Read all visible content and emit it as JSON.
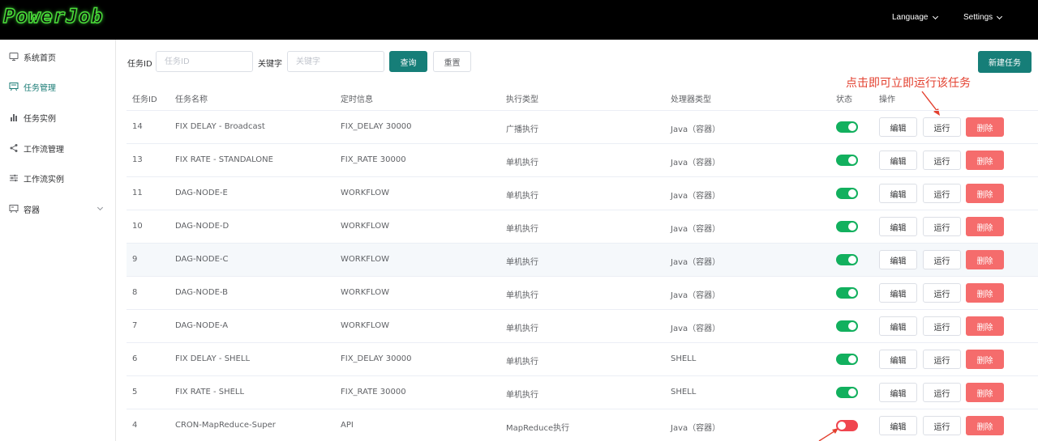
{
  "header": {
    "logo": "PowerJob",
    "language_label": "Language",
    "settings_label": "Settings"
  },
  "sidebar": {
    "items": [
      {
        "label": "系统首页",
        "icon": "monitor-icon"
      },
      {
        "label": "任务管理",
        "icon": "task-board-icon",
        "active": true
      },
      {
        "label": "任务实例",
        "icon": "bar-chart-icon"
      },
      {
        "label": "工作流管理",
        "icon": "share-icon"
      },
      {
        "label": "工作流实例",
        "icon": "sliders-icon"
      },
      {
        "label": "容器",
        "icon": "presentation-icon",
        "expandable": true
      }
    ]
  },
  "search": {
    "task_id_label": "任务ID",
    "task_id_placeholder": "任务ID",
    "keyword_label": "关键字",
    "keyword_placeholder": "关键字",
    "query_button": "查询",
    "reset_button": "重置",
    "new_task_button": "新建任务"
  },
  "annotation": {
    "text": "点击即可立即运行该任务",
    "color": "#e3402f"
  },
  "table": {
    "columns": [
      "任务ID",
      "任务名称",
      "定时信息",
      "执行类型",
      "处理器类型",
      "状态",
      "操作"
    ],
    "action_labels": {
      "edit": "编辑",
      "run": "运行",
      "delete": "删除"
    },
    "rows": [
      {
        "id": "14",
        "name": "FIX DELAY - Broadcast",
        "schedule": "FIX_DELAY 30000",
        "exec_type": "广播执行",
        "processor": "Java（容器）",
        "enabled": true
      },
      {
        "id": "13",
        "name": "FIX RATE - STANDALONE",
        "schedule": "FIX_RATE 30000",
        "exec_type": "单机执行",
        "processor": "Java（容器）",
        "enabled": true
      },
      {
        "id": "11",
        "name": "DAG-NODE-E",
        "schedule": "WORKFLOW",
        "exec_type": "单机执行",
        "processor": "Java（容器）",
        "enabled": true
      },
      {
        "id": "10",
        "name": "DAG-NODE-D",
        "schedule": "WORKFLOW",
        "exec_type": "单机执行",
        "processor": "Java（容器）",
        "enabled": true
      },
      {
        "id": "9",
        "name": "DAG-NODE-C",
        "schedule": "WORKFLOW",
        "exec_type": "单机执行",
        "processor": "Java（容器）",
        "enabled": true
      },
      {
        "id": "8",
        "name": "DAG-NODE-B",
        "schedule": "WORKFLOW",
        "exec_type": "单机执行",
        "processor": "Java（容器）",
        "enabled": true
      },
      {
        "id": "7",
        "name": "DAG-NODE-A",
        "schedule": "WORKFLOW",
        "exec_type": "单机执行",
        "processor": "Java（容器）",
        "enabled": true
      },
      {
        "id": "6",
        "name": "FIX DELAY - SHELL",
        "schedule": "FIX_DELAY 30000",
        "exec_type": "单机执行",
        "processor": "SHELL",
        "enabled": true
      },
      {
        "id": "5",
        "name": "FIX RATE - SHELL",
        "schedule": "FIX_RATE 30000",
        "exec_type": "单机执行",
        "processor": "SHELL",
        "enabled": true
      },
      {
        "id": "4",
        "name": "CRON-MapReduce-Super",
        "schedule": "API",
        "exec_type": "MapReduce执行",
        "processor": "Java（容器）",
        "enabled": false
      }
    ]
  },
  "colors": {
    "primary": "#167e78",
    "switch_on": "#12b05e",
    "switch_off": "#f0454f",
    "danger": "#f56c6c"
  }
}
